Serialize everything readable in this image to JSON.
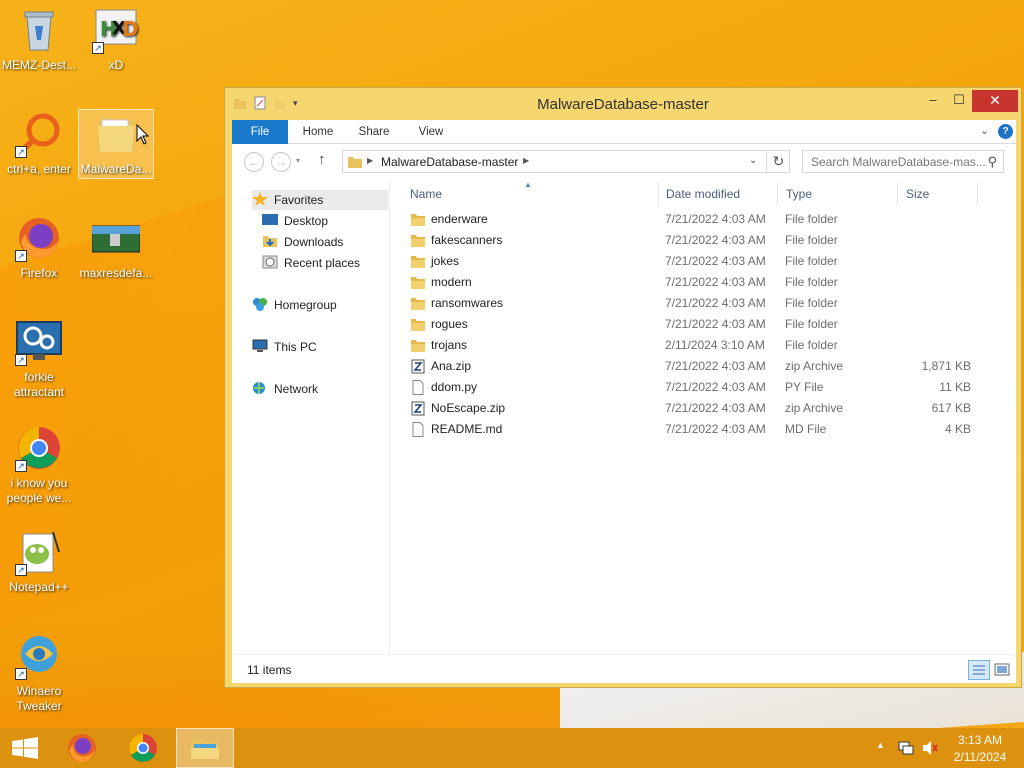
{
  "desktop": {
    "icons": [
      {
        "label": "MEMZ-Dest...",
        "icon": "recycle-bin-icon"
      },
      {
        "label": "xD",
        "icon": "hxd-icon"
      },
      {
        "label": "ctrl+a, enter",
        "icon": "magnifier-shortcut-icon"
      },
      {
        "label": "MalwareDa...",
        "icon": "folder-icon"
      },
      {
        "label": "Firefox",
        "icon": "firefox-icon"
      },
      {
        "label": "maxresdefa...",
        "icon": "image-thumbnail-icon"
      },
      {
        "label": "forkie attractant",
        "icon": "settings-monitor-icon"
      },
      {
        "label": "i know you people we...",
        "icon": "chrome-icon"
      },
      {
        "label": "Notepad++",
        "icon": "notepadpp-icon"
      },
      {
        "label": "Winaero Tweaker",
        "icon": "winaero-icon"
      }
    ]
  },
  "window": {
    "title": "MalwareDatabase-master",
    "controls": {
      "minimize": "–",
      "maximize": "☐",
      "close": "✕"
    },
    "ribbon_tabs": [
      "File",
      "Home",
      "Share",
      "View"
    ],
    "help": "?",
    "address": {
      "crumb": "MalwareDatabase-master"
    },
    "search_placeholder": "Search MalwareDatabase-mas...",
    "nav_pane": {
      "favorites": "Favorites",
      "favorites_items": [
        "Desktop",
        "Downloads",
        "Recent places"
      ],
      "homegroup": "Homegroup",
      "this_pc": "This PC",
      "network": "Network"
    },
    "columns": {
      "name": "Name",
      "date": "Date modified",
      "type": "Type",
      "size": "Size"
    },
    "files": [
      {
        "name": "enderware",
        "date": "7/21/2022 4:03 AM",
        "type": "File folder",
        "size": "",
        "icon": "folder-icon"
      },
      {
        "name": "fakescanners",
        "date": "7/21/2022 4:03 AM",
        "type": "File folder",
        "size": "",
        "icon": "folder-icon"
      },
      {
        "name": "jokes",
        "date": "7/21/2022 4:03 AM",
        "type": "File folder",
        "size": "",
        "icon": "folder-icon"
      },
      {
        "name": "modern",
        "date": "7/21/2022 4:03 AM",
        "type": "File folder",
        "size": "",
        "icon": "folder-icon"
      },
      {
        "name": "ransomwares",
        "date": "7/21/2022 4:03 AM",
        "type": "File folder",
        "size": "",
        "icon": "folder-icon"
      },
      {
        "name": "rogues",
        "date": "7/21/2022 4:03 AM",
        "type": "File folder",
        "size": "",
        "icon": "folder-icon"
      },
      {
        "name": "trojans",
        "date": "2/11/2024 3:10 AM",
        "type": "File folder",
        "size": "",
        "icon": "folder-icon"
      },
      {
        "name": "Ana.zip",
        "date": "7/21/2022 4:03 AM",
        "type": "zip Archive",
        "size": "1,871 KB",
        "icon": "zip-icon"
      },
      {
        "name": "ddom.py",
        "date": "7/21/2022 4:03 AM",
        "type": "PY File",
        "size": "11 KB",
        "icon": "file-icon"
      },
      {
        "name": "NoEscape.zip",
        "date": "7/21/2022 4:03 AM",
        "type": "zip Archive",
        "size": "617 KB",
        "icon": "zip-icon"
      },
      {
        "name": "README.md",
        "date": "7/21/2022 4:03 AM",
        "type": "MD File",
        "size": "4 KB",
        "icon": "file-icon"
      }
    ],
    "status": "11 items"
  },
  "taskbar": {
    "pinned": [
      "start-icon",
      "firefox-icon",
      "chrome-icon",
      "file-explorer-icon"
    ],
    "clock_time": "3:13 AM",
    "clock_date": "2/11/2024"
  },
  "colors": {
    "wallpaper": "#f4a30a",
    "window_frame": "#f6d66e",
    "file_tab": "#1979ca",
    "close_button": "#c7352e",
    "taskbar": "#dc920f"
  }
}
